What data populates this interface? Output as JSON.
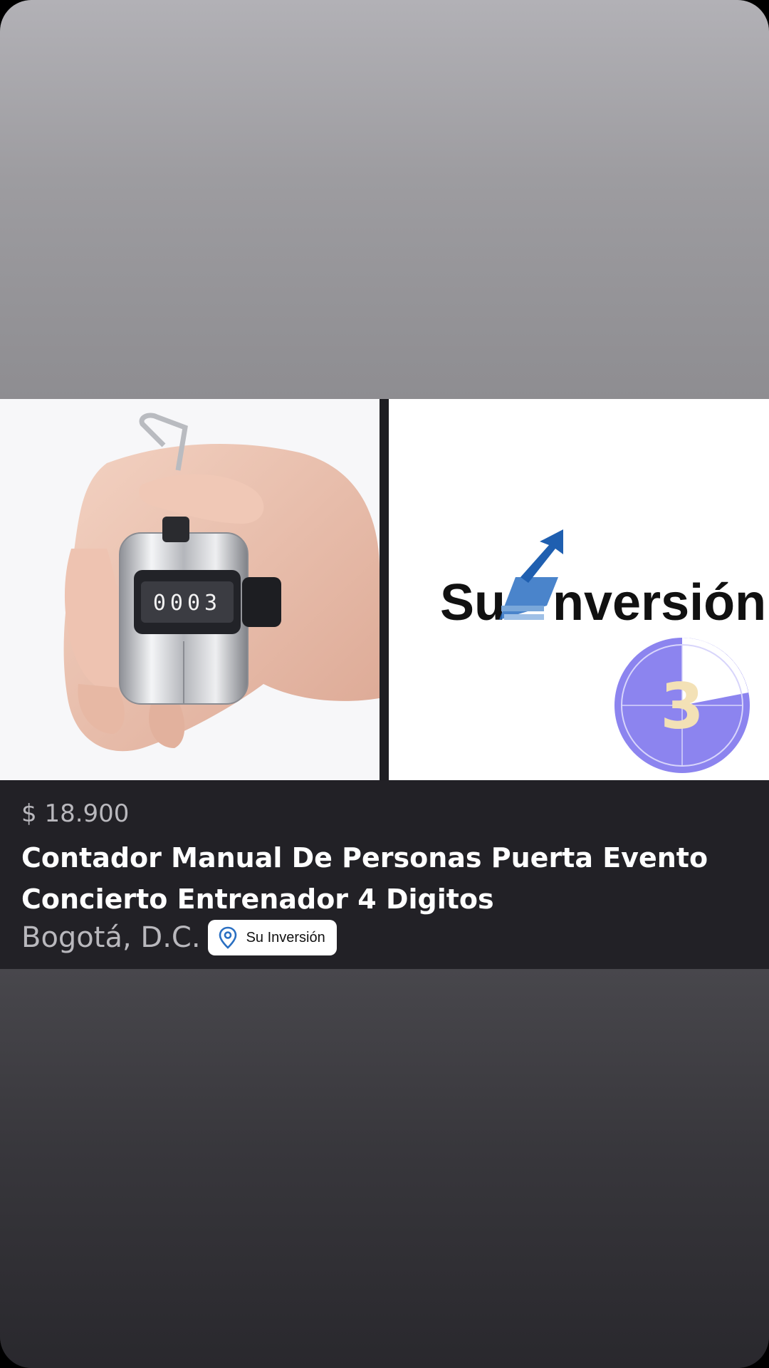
{
  "listing": {
    "price": "$ 18.900",
    "title": "Contador Manual De Personas Puerta Evento Concierto Entrenador 4 Digitos",
    "location": "Bogotá, D.C.",
    "seller": {
      "name": "Su Inversión",
      "icon": "location-pin-icon"
    }
  },
  "media": {
    "left_image": {
      "counter_display": "0003"
    },
    "right_image": {
      "logo_text_prefix": "Su",
      "logo_text_suffix": "nversión",
      "badge_number": "3"
    }
  },
  "colors": {
    "info_background": "#222126",
    "logo_blue": "#2a6fc2",
    "badge_purple": "#8c84ef",
    "badge_numeral": "#f3e1b6"
  }
}
